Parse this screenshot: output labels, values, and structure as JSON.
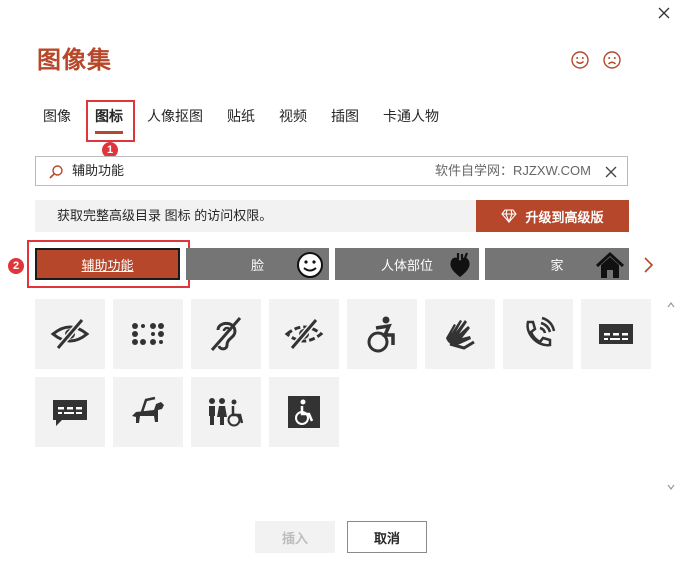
{
  "dialog": {
    "title": "图像集"
  },
  "tabs": [
    {
      "label": "图像"
    },
    {
      "label": "图标",
      "active": true
    },
    {
      "label": "人像抠图"
    },
    {
      "label": "贴纸"
    },
    {
      "label": "视频"
    },
    {
      "label": "插图"
    },
    {
      "label": "卡通人物"
    }
  ],
  "annotations": {
    "badge1": "1",
    "badge2": "2"
  },
  "search": {
    "value": "辅助功能",
    "watermark": "软件自学网：RJZXW.COM"
  },
  "banner": {
    "text": "获取完整高级目录 图标 的访问权限。",
    "upgrade_label": "升级到高级版"
  },
  "categories": [
    {
      "label": "辅助功能",
      "selected": true
    },
    {
      "label": "脸",
      "icon": "smiley-icon"
    },
    {
      "label": "人体部位",
      "icon": "heart-organ-icon"
    },
    {
      "label": "家",
      "icon": "house-icon"
    }
  ],
  "icons": [
    "eye-slash-icon",
    "braille-icon",
    "deaf-ear-icon",
    "low-vision-icon",
    "wheelchair-active-icon",
    "sign-language-icon",
    "volume-phone-icon",
    "closed-caption-icon",
    "tty-chat-icon",
    "guide-dog-icon",
    "accessible-restroom-icon",
    "wheelchair-sign-icon"
  ],
  "footer": {
    "insert_label": "插入",
    "cancel_label": "取消"
  },
  "colors": {
    "accent": "#b7472a",
    "annotation": "#e0353a",
    "category_bg": "#757575"
  }
}
